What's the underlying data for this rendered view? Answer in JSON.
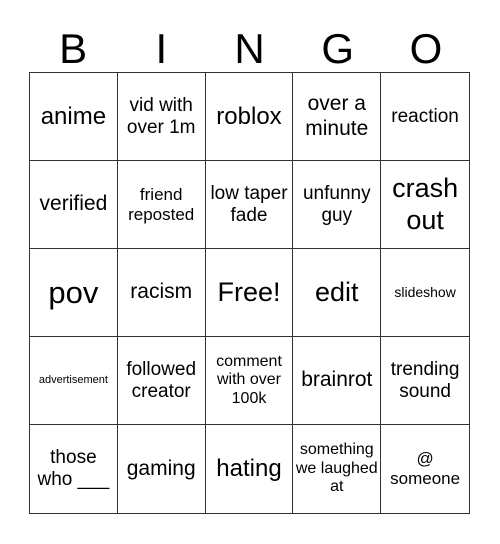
{
  "header": [
    "B",
    "I",
    "N",
    "G",
    "O"
  ],
  "cells": [
    "anime",
    "vid with over 1m",
    "roblox",
    "over a minute",
    "reaction",
    "verified",
    "friend reposted",
    "low taper fade",
    "unfunny guy",
    "crash out",
    "pov",
    "racism",
    "Free!",
    "edit",
    "slideshow",
    "advertisement",
    "followed creator",
    "comment with over 100k",
    "brainrot",
    "trending sound",
    "those who ___",
    "gaming",
    "hating",
    "something we laughed at",
    "@ someone"
  ]
}
